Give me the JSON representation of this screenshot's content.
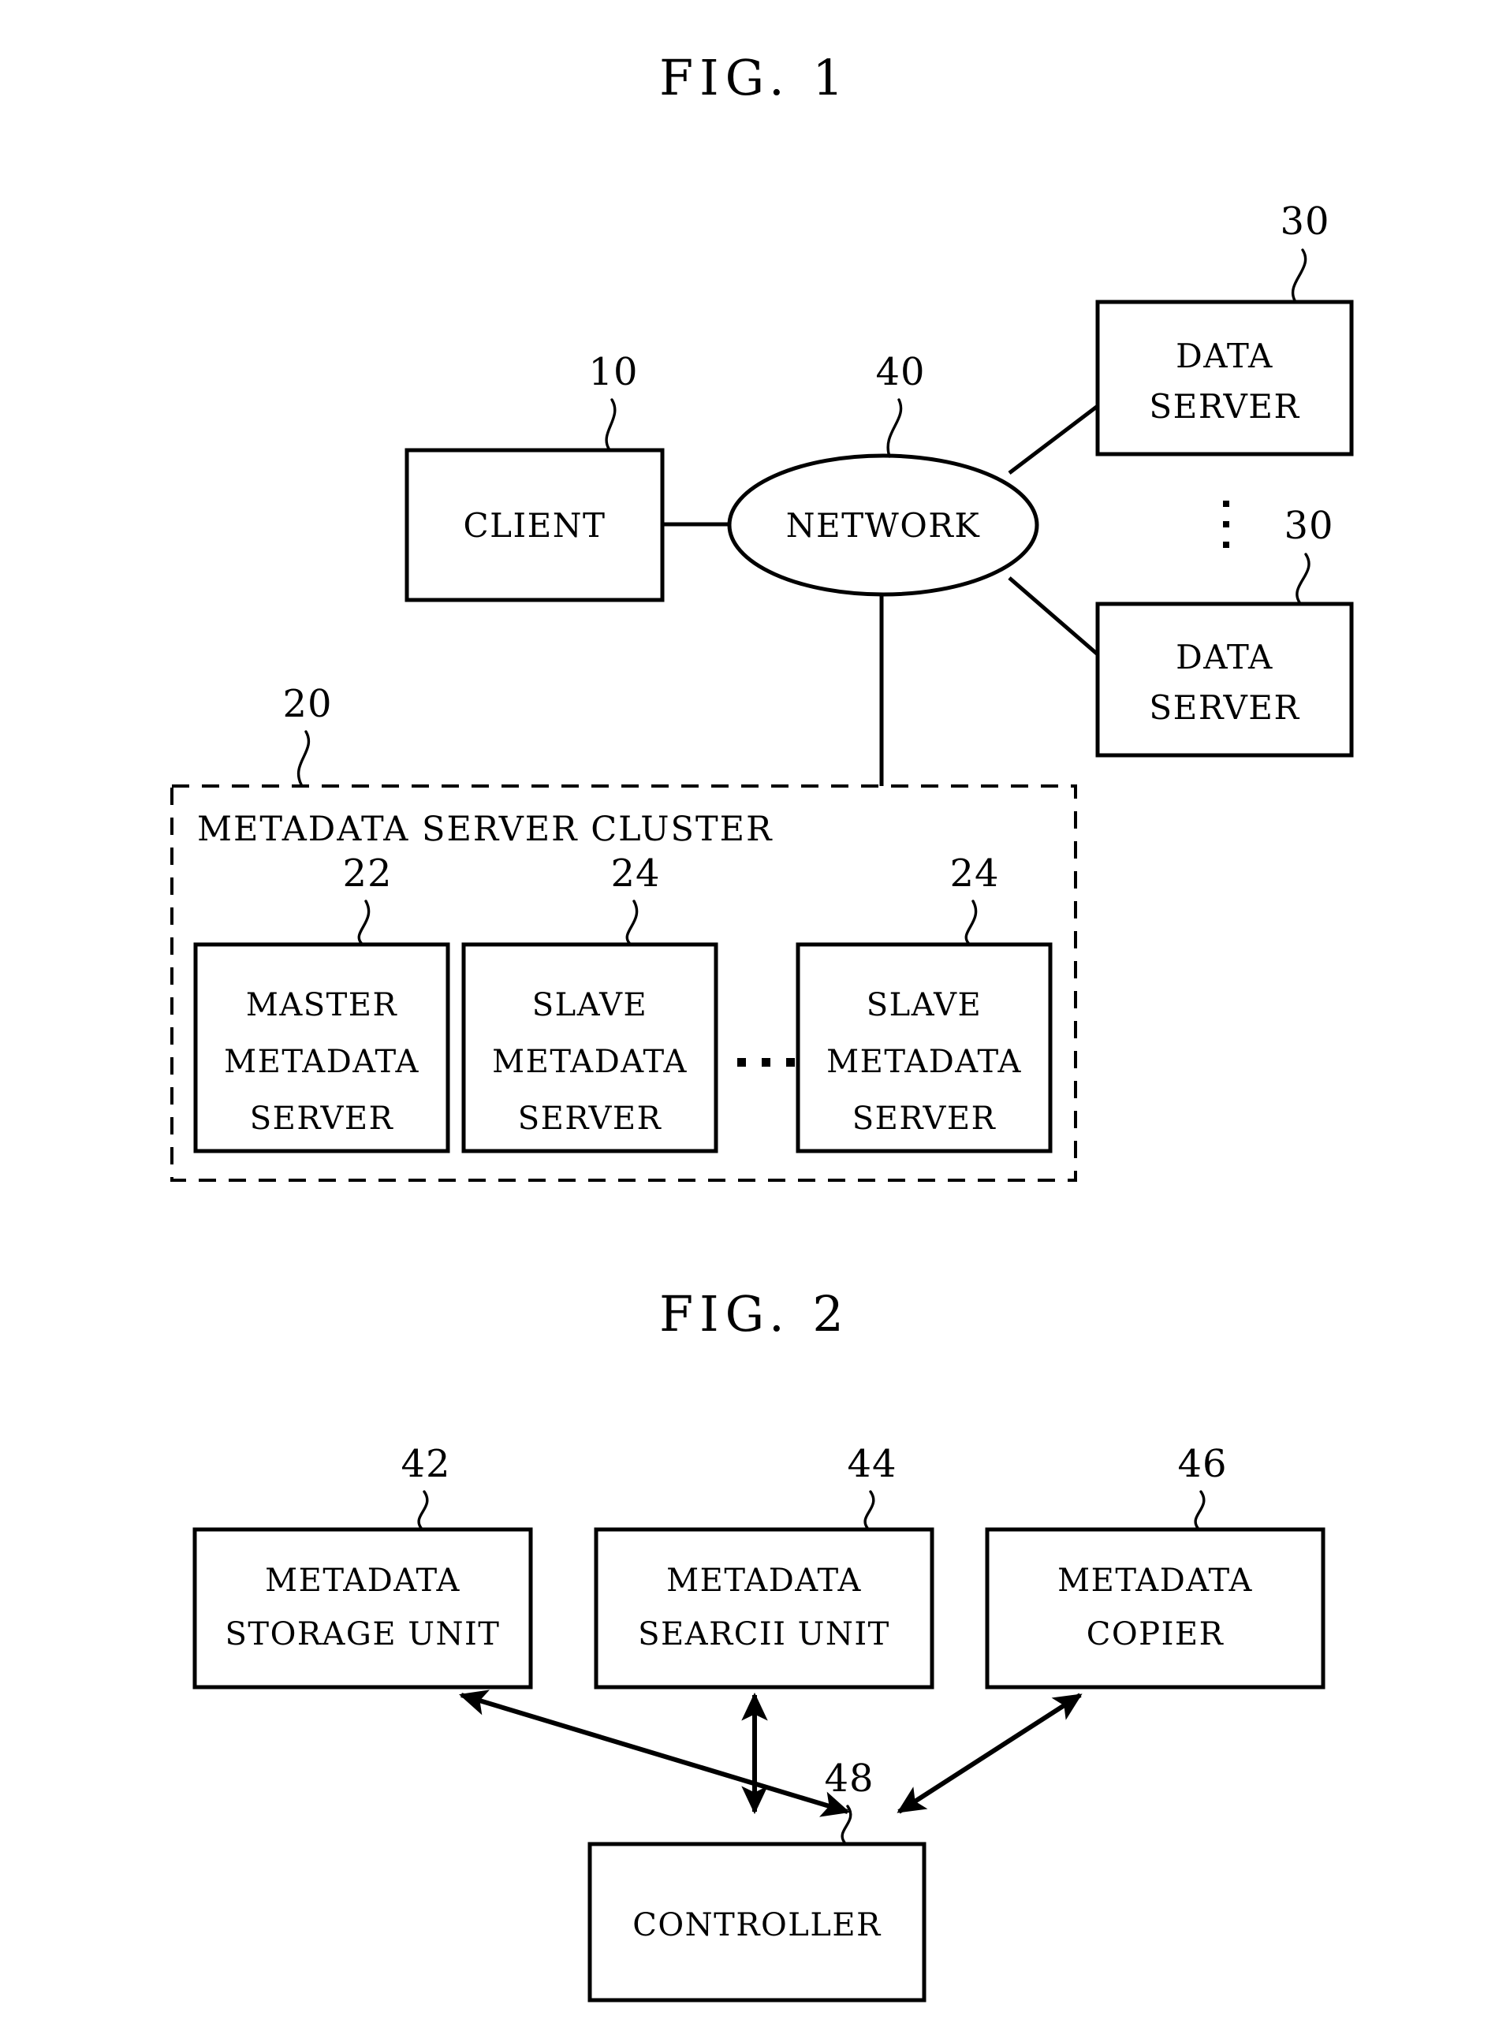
{
  "document": {
    "type": "patent-drawing-sheet",
    "background_color": "#ffffff",
    "line_color": "#000000"
  },
  "figures": [
    {
      "id": "fig1",
      "title": "FIG. 1",
      "nodes": {
        "client": {
          "label": "CLIENT",
          "ref": "10"
        },
        "network": {
          "label": "NETWORK",
          "ref": "40"
        },
        "data_server_1": {
          "label_line1": "DATA",
          "label_line2": "SERVER",
          "ref": "30"
        },
        "data_server_2": {
          "label_line1": "DATA",
          "label_line2": "SERVER",
          "ref": "30"
        },
        "cluster": {
          "label": "METADATA SERVER CLUSTER",
          "ref": "20"
        },
        "master_metadata_server": {
          "label_line1": "MASTER",
          "label_line2": "METADATA",
          "label_line3": "SERVER",
          "ref": "22"
        },
        "slave_metadata_server_1": {
          "label_line1": "SLAVE",
          "label_line2": "METADATA",
          "label_line3": "SERVER",
          "ref": "24"
        },
        "slave_metadata_server_2": {
          "label_line1": "SLAVE",
          "label_line2": "METADATA",
          "label_line3": "SERVER",
          "ref": "24"
        }
      },
      "ellipsis": {
        "vertical_between_data_servers": "⋮",
        "horizontal_between_slaves": "…"
      }
    },
    {
      "id": "fig2",
      "title": "FIG. 2",
      "nodes": {
        "metadata_storage_unit": {
          "label_line1": "METADATA",
          "label_line2": "STORAGE UNIT",
          "ref": "42"
        },
        "metadata_search_unit": {
          "label_line1": "METADATA",
          "label_line2": "SEARCII UNIT",
          "ref": "44"
        },
        "metadata_copier": {
          "label_line1": "METADATA",
          "label_line2": "COPIER",
          "ref": "46"
        },
        "controller": {
          "label": "CONTROLLER",
          "ref": "48"
        }
      },
      "connections": [
        {
          "from": "controller",
          "to": "metadata_storage_unit",
          "arrow": "bidirectional"
        },
        {
          "from": "controller",
          "to": "metadata_search_unit",
          "arrow": "bidirectional"
        },
        {
          "from": "controller",
          "to": "metadata_copier",
          "arrow": "bidirectional"
        }
      ]
    }
  ]
}
